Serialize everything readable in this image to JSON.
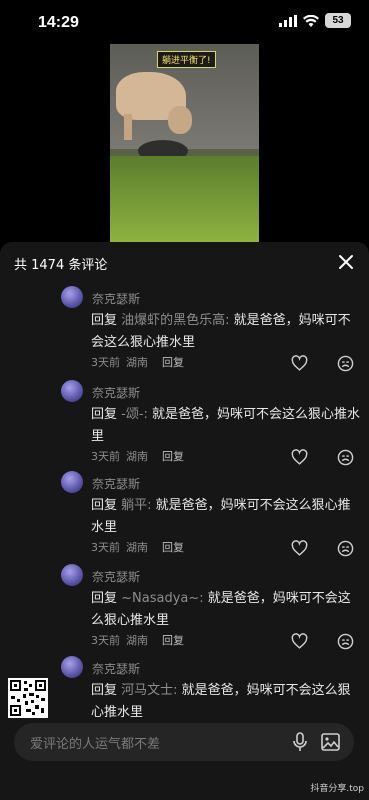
{
  "status_bar": {
    "time": "14:29",
    "battery": "53"
  },
  "video": {
    "caption": "躺进平衡了!"
  },
  "sheet": {
    "title": "共 1474 条评论",
    "comments": [
      {
        "author": "奈克瑟斯",
        "reply_word": "回复",
        "target": "油爆虾的黑色乐高:",
        "text": " 就是爸爸，妈咪可不会这么狠心推水里",
        "time": "3天前",
        "location": "湖南",
        "reply_label": "回复"
      },
      {
        "author": "奈克瑟斯",
        "reply_word": "回复",
        "target": "-颂-:",
        "text": " 就是爸爸，妈咪可不会这么狠心推水里",
        "time": "3天前",
        "location": "湖南",
        "reply_label": "回复"
      },
      {
        "author": "奈克瑟斯",
        "reply_word": "回复",
        "target": "躺平:",
        "text": " 就是爸爸，妈咪可不会这么狠心推水里",
        "time": "3天前",
        "location": "湖南",
        "reply_label": "回复"
      },
      {
        "author": "奈克瑟斯",
        "reply_word": "回复",
        "target": "~Nasadya~:",
        "text": " 就是爸爸，妈咪可不会这么狠心推水里",
        "time": "3天前",
        "location": "湖南",
        "reply_label": "回复"
      },
      {
        "author": "奈克瑟斯",
        "reply_word": "回复",
        "target": "河马文士:",
        "text": " 就是爸爸，妈咪可不会这么狠心推水里"
      }
    ]
  },
  "input": {
    "placeholder": "爱评论的人运气都不差"
  },
  "watermark": "抖音分享.top",
  "icons": [
    "signal-icon",
    "wifi-icon",
    "battery-icon",
    "close-icon",
    "heart-icon",
    "dislike-icon",
    "mic-icon",
    "image-icon",
    "qr-code"
  ]
}
